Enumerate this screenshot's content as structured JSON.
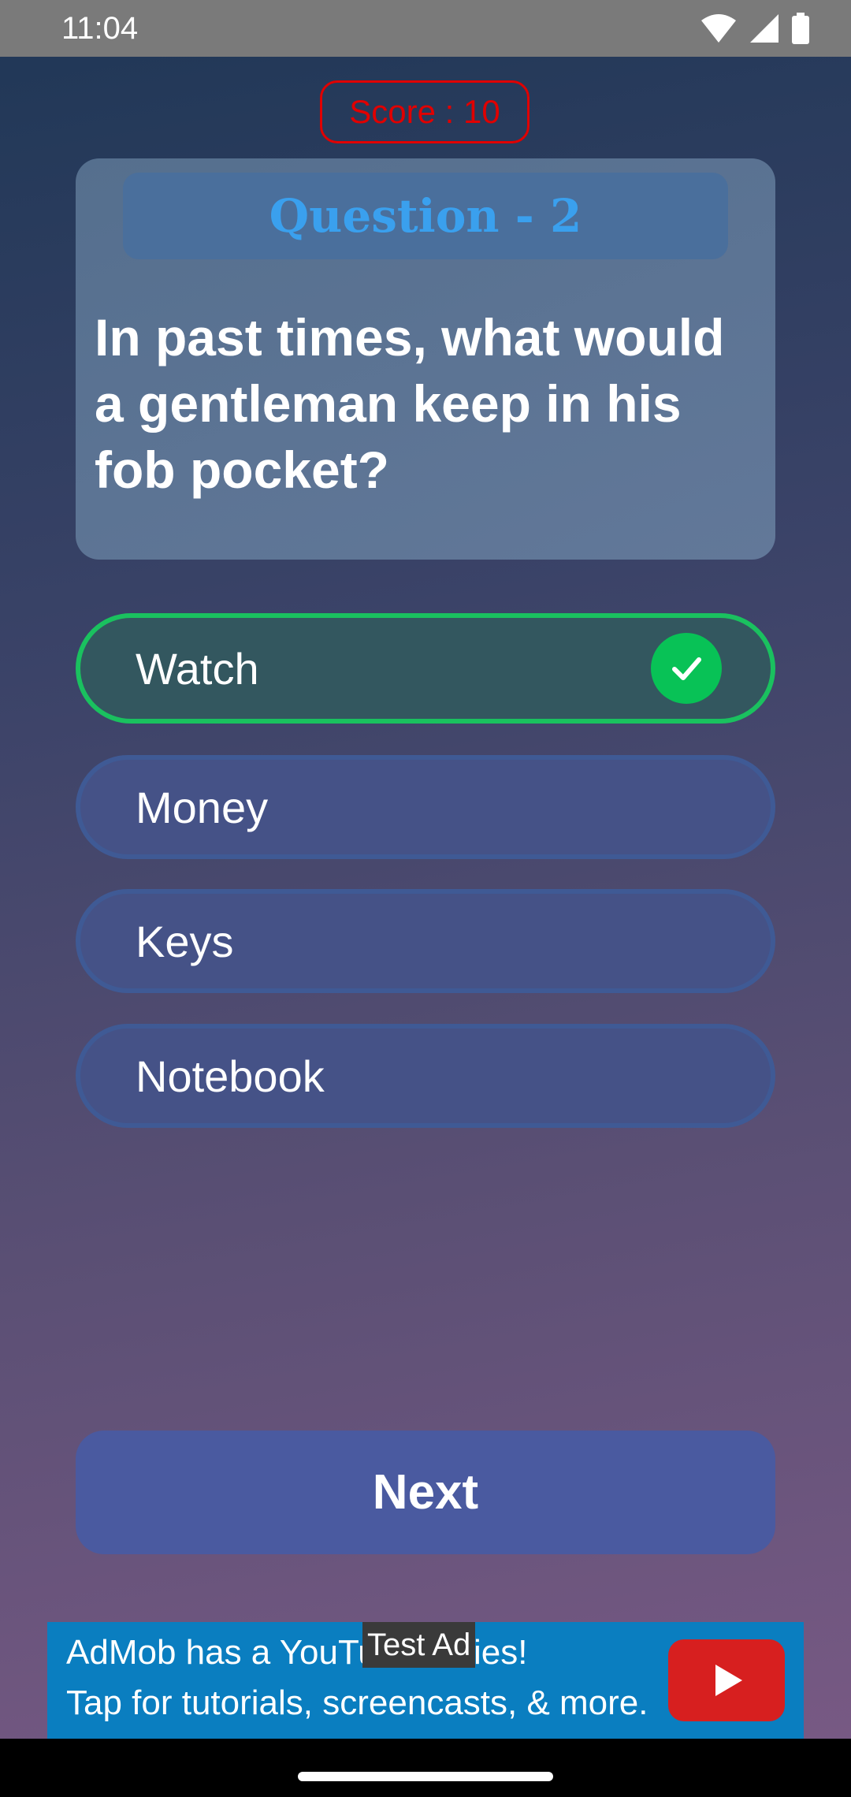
{
  "status_bar": {
    "time": "11:04"
  },
  "score": {
    "label": "Score : 10",
    "color": "#e00000"
  },
  "question": {
    "header": "Question - 2",
    "text": "In past times, what would a gentleman keep in his fob pocket?"
  },
  "options": [
    {
      "label": "Watch",
      "state": "correct"
    },
    {
      "label": "Money",
      "state": "default"
    },
    {
      "label": "Keys",
      "state": "default"
    },
    {
      "label": "Notebook",
      "state": "default"
    }
  ],
  "next_button": {
    "label": "Next"
  },
  "ad": {
    "test_label": "Test Ad",
    "line1": "AdMob has a YouTube series!",
    "line2": "Tap for tutorials, screencasts, & more.",
    "icon": "youtube-play-icon"
  },
  "colors": {
    "correct": "#1ac15f",
    "option_border": "#3f5a95",
    "header_text": "#3aa0ee",
    "ad_background": "#0a7ec0"
  }
}
